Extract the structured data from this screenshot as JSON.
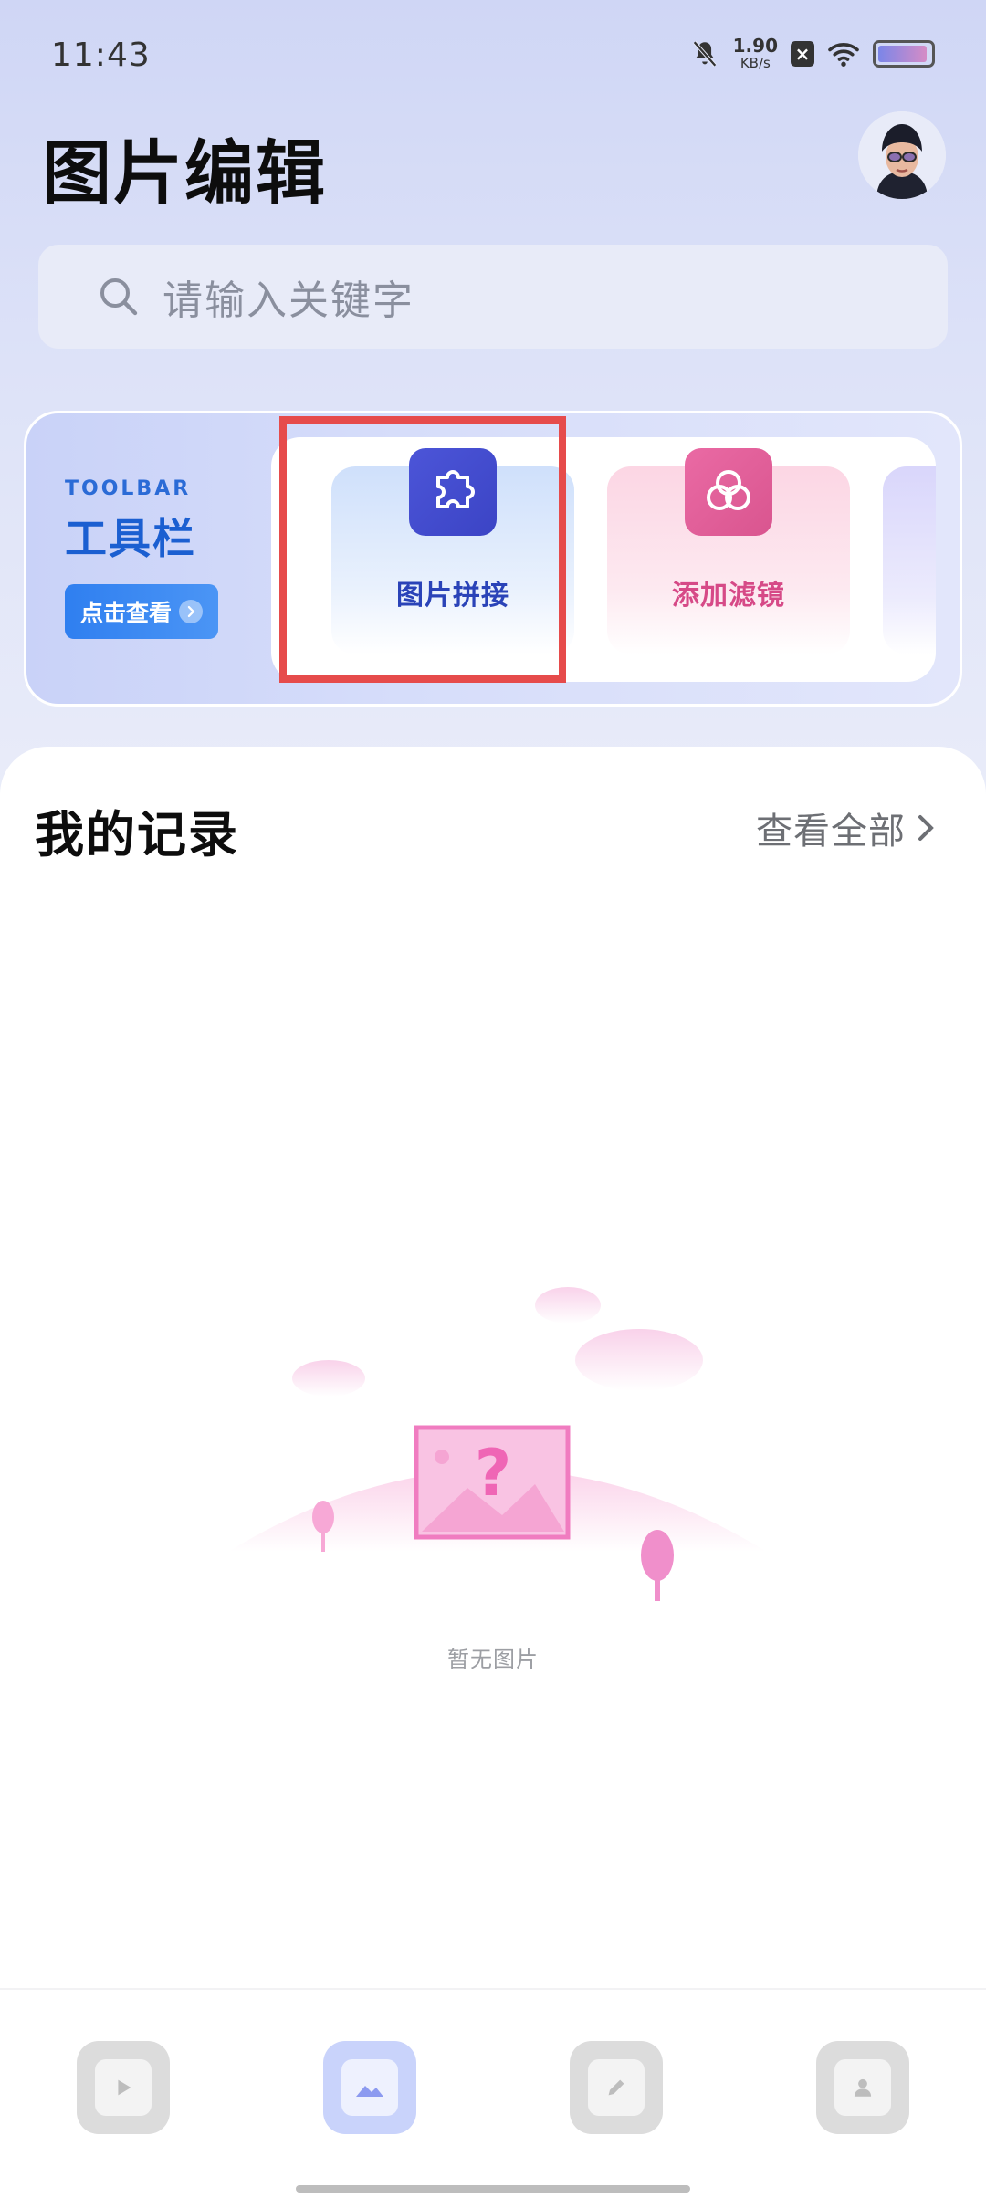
{
  "status_bar": {
    "time": "11:43",
    "net_speed_value": "1.90",
    "net_speed_unit": "KB/s",
    "battery_level": 0.95
  },
  "header": {
    "title": "图片编辑"
  },
  "search": {
    "placeholder": "请输入关键字"
  },
  "toolbar": {
    "eyebrow": "TOOLBAR",
    "heading": "工具栏",
    "view_button": "点击查看",
    "tools": [
      {
        "label": "图片拼接",
        "icon": "puzzle-icon"
      },
      {
        "label": "添加滤镜",
        "icon": "filter-icon"
      }
    ]
  },
  "records": {
    "title": "我的记录",
    "view_all": "查看全部",
    "empty_text": "暂无图片"
  },
  "bottom_nav": {
    "items": [
      {
        "icon": "video-icon",
        "active": false
      },
      {
        "icon": "image-icon",
        "active": true
      },
      {
        "icon": "edit-icon",
        "active": false
      },
      {
        "icon": "profile-icon",
        "active": false
      }
    ]
  },
  "colors": {
    "accent_blue": "#2f7ff0",
    "puzzle_icon_bg": "#4c55d8",
    "filter_icon_bg": "#ea6aa4",
    "highlight_red": "#e64b4b"
  }
}
